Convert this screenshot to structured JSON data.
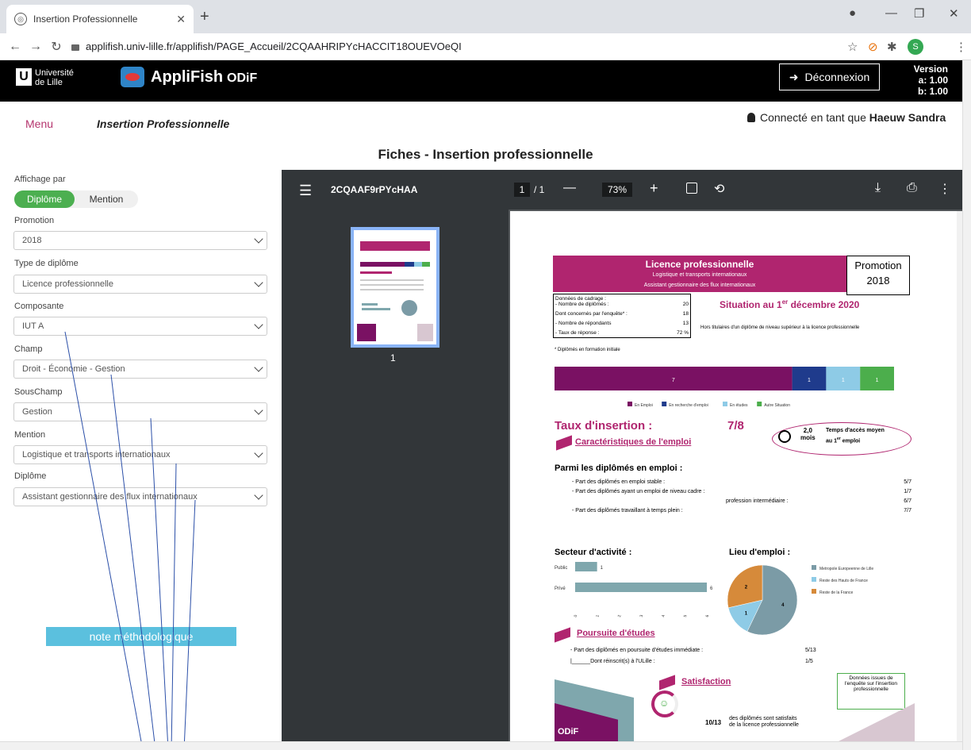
{
  "browser": {
    "tab_title": "Insertion Professionnelle",
    "url": "applifish.univ-lille.fr/applifish/PAGE_Accueil/2CQAAHRIPYcHACCIT18OUEVOeQI",
    "profile_initial": "S"
  },
  "header": {
    "univ_line1": "Université",
    "univ_line2": "de Lille",
    "app_name": "AppliFish",
    "app_sub": "ODiF",
    "logout_label": "Déconnexion",
    "version_title": "Version",
    "version_a": "a: 1.00",
    "version_b": "b: 1.00"
  },
  "subheader": {
    "menu": "Menu",
    "title": "Insertion Professionnelle",
    "connected_prefix": "Connecté en tant que ",
    "user": "Haeuw Sandra",
    "page_heading": "Fiches - Insertion professionnelle"
  },
  "filters": {
    "affichage_label": "Affichage par",
    "toggle_on": "Diplôme",
    "toggle_off": "Mention",
    "promotion_label": "Promotion",
    "promotion_value": "2018",
    "type_label": "Type de diplôme",
    "type_value": "Licence professionnelle",
    "composante_label": "Composante",
    "composante_value": "IUT A",
    "champ_label": "Champ",
    "champ_value": "Droit - Économie - Gestion",
    "souschamp_label": "SousChamp",
    "souschamp_value": "Gestion",
    "mention_label": "Mention",
    "mention_value": "Logistique et transports internationaux",
    "diplome_label": "Diplôme",
    "diplome_value": "Assistant gestionnaire des flux internationaux",
    "note_button": "note méthodologique"
  },
  "pdf": {
    "doc_title": "2CQAAF9rPYcHAA",
    "page_current": "1",
    "page_total": "/ 1",
    "zoom": "73%",
    "thumb_number": "1"
  },
  "sheet": {
    "banner_title": "Licence professionnelle",
    "banner_mention": "Logistique et transports internationaux",
    "banner_diplome": "Assistant gestionnaire des flux internationaux",
    "promo_label": "Promotion",
    "promo_year": "2018",
    "cadrage_title": "Données de cadrage :",
    "cadrage_rows": [
      {
        "label": "- Nombre de diplômés :",
        "value": "20"
      },
      {
        "label": "Dont concernés par l'enquête* :",
        "value": "18"
      },
      {
        "label": "- Nombre de répondants",
        "value": "13"
      },
      {
        "label": "- Taux de réponse :",
        "value": "72 %"
      }
    ],
    "situation_prefix": "Situation au 1",
    "situation_sup": "er",
    "situation_suffix": " décembre 2020",
    "hors_titulaires": "Hors titulaires d'un diplôme de niveau supérieur à la licence professionnelle",
    "footnote": "* Diplômés en formation initiale",
    "taux_label": "Taux d'insertion :",
    "taux_value": "7/8",
    "acces_value": "2,0",
    "acces_unit": "mois",
    "acces_label1": "Temps d'accès moyen",
    "acces_label2a": "au 1",
    "acces_label2sup": "er",
    "acces_label2b": " emploi",
    "carac_title": "Caractéristiques de l'emploi",
    "parmi_title": "Parmi les diplômés en emploi :",
    "emploi_rows": [
      {
        "label": "- Part des diplômés en emploi stable :",
        "value": "5/7"
      },
      {
        "label": "- Part des diplômés ayant un emploi de niveau cadre :",
        "value": "1/7"
      },
      {
        "label": "profession intermédiaire :",
        "value": "6/7"
      },
      {
        "label": "- Part des diplômés travaillant à temps plein :",
        "value": "7/7"
      }
    ],
    "secteur_title": "Secteur d'activité :",
    "lieu_title": "Lieu d'emploi :",
    "poursuite_title": "Poursuite d'études",
    "poursuite_rows": [
      {
        "label": "- Part des diplômés en poursuite d'études immédiate :",
        "value": "5/13"
      },
      {
        "label": "|______Dont réinscrit(s) à l'ULille :",
        "value": "1/5"
      }
    ],
    "satisfaction_title": "Satisfaction",
    "donnees_box": "Données issues de l'enquête sur l'insertion professionnelle",
    "satis_value": "10/13",
    "satis_text": "des diplômés sont satisfaits de la licence professionnelle",
    "odif": "ODiF"
  },
  "chart_data": [
    {
      "type": "bar",
      "orientation": "horizontal-stacked",
      "categories": [
        "En Emploi",
        "En recherche d'emploi",
        "En études",
        "Autre Situation"
      ],
      "values": [
        7,
        1,
        1,
        1
      ],
      "colors": [
        "#7a1163",
        "#1f3b8c",
        "#8ecbe6",
        "#4cae4c"
      ]
    },
    {
      "type": "bar",
      "orientation": "horizontal",
      "categories": [
        "Public",
        "Privé"
      ],
      "values": [
        1,
        6
      ],
      "xlim": [
        0,
        6
      ],
      "ticks": [
        "0",
        "1",
        "2",
        "3",
        "4",
        "5",
        "6"
      ],
      "color": "#7fa7ad"
    },
    {
      "type": "pie",
      "categories": [
        "Metropole Europeenne de Lille",
        "Reste des Hauts de France",
        "Reste de la France"
      ],
      "values": [
        4,
        1,
        2
      ],
      "colors": [
        "#7b9ba6",
        "#8ecbe6",
        "#d68a3a"
      ]
    }
  ]
}
